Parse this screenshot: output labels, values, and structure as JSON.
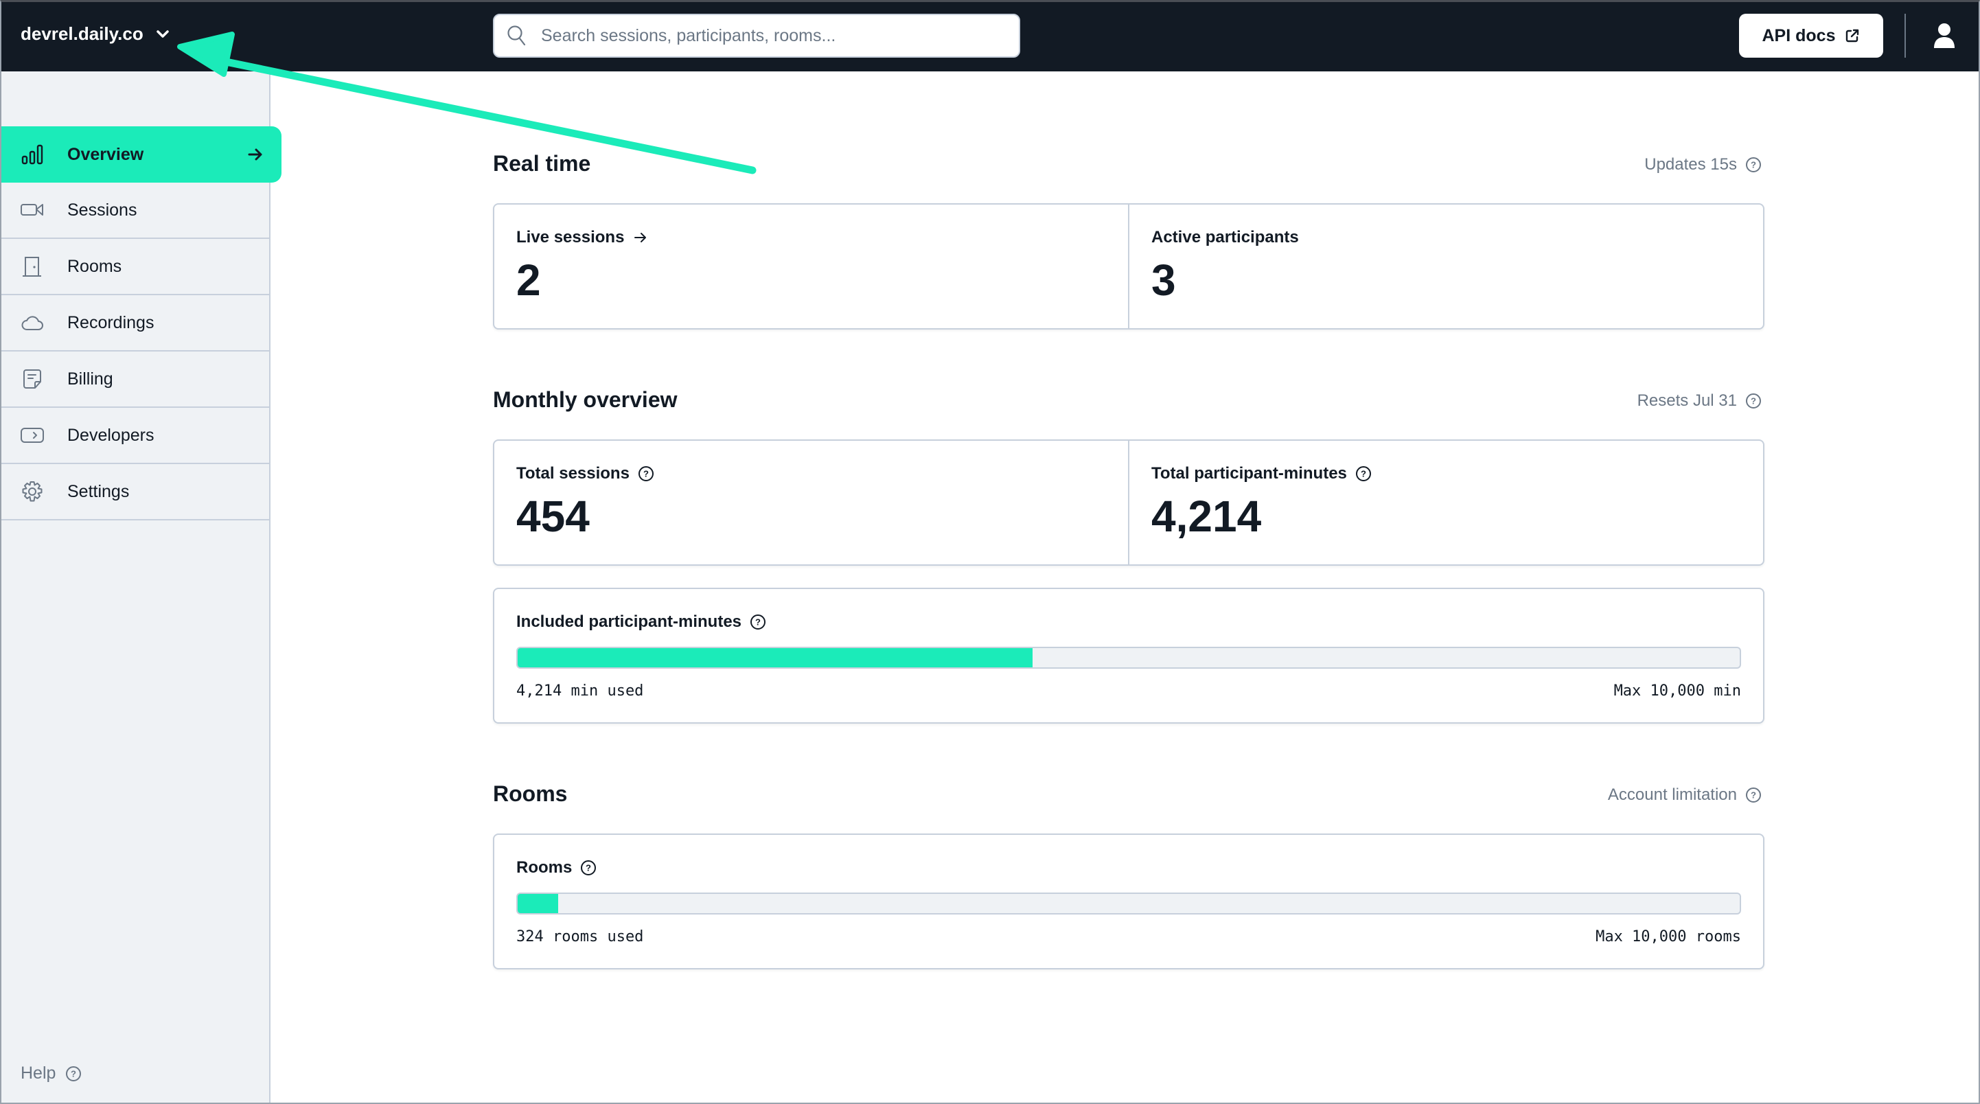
{
  "topbar": {
    "org_name": "devrel.daily.co",
    "search_placeholder": "Search sessions, participants, rooms...",
    "api_docs_label": "API docs"
  },
  "sidebar": {
    "items": [
      {
        "label": "Overview",
        "icon": "bar-chart-icon",
        "active": true
      },
      {
        "label": "Sessions",
        "icon": "video-camera-icon"
      },
      {
        "label": "Rooms",
        "icon": "door-icon"
      },
      {
        "label": "Recordings",
        "icon": "cloud-icon"
      },
      {
        "label": "Billing",
        "icon": "receipt-icon"
      },
      {
        "label": "Developers",
        "icon": "terminal-icon"
      },
      {
        "label": "Settings",
        "icon": "gear-icon"
      }
    ],
    "help_label": "Help"
  },
  "realtime": {
    "title": "Real time",
    "meta": "Updates 15s",
    "live_sessions_label": "Live sessions",
    "live_sessions_value": "2",
    "active_participants_label": "Active participants",
    "active_participants_value": "3"
  },
  "monthly": {
    "title": "Monthly overview",
    "meta": "Resets Jul 31",
    "total_sessions_label": "Total sessions",
    "total_sessions_value": "454",
    "total_minutes_label": "Total participant-minutes",
    "total_minutes_value": "4,214",
    "included_label": "Included participant-minutes",
    "included_used": "4,214 min used",
    "included_max": "Max 10,000 min",
    "included_progress_percent": 42.14
  },
  "rooms": {
    "title": "Rooms",
    "meta": "Account limitation",
    "card_label": "Rooms",
    "used": "324 rooms used",
    "max": "Max 10,000 rooms",
    "progress_percent": 3.24
  },
  "colors": {
    "accent": "#1bebb9",
    "topbar_bg": "#121a24",
    "sidebar_bg": "#eff2f5",
    "border": "#c7d0dc",
    "muted_text": "#6b7785"
  }
}
